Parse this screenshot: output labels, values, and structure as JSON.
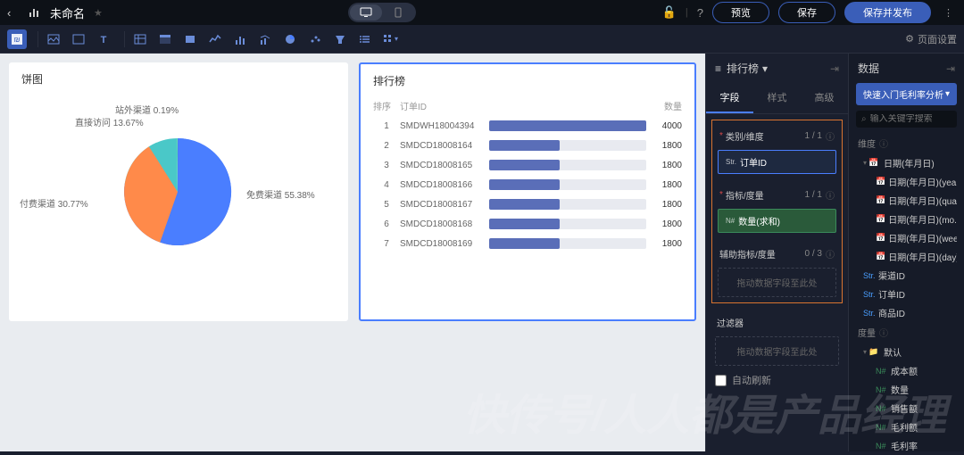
{
  "topbar": {
    "title": "未命名",
    "preview": "预览",
    "save": "保存",
    "savePublish": "保存并发布"
  },
  "toolbar": {
    "pageSettings": "页面设置"
  },
  "pie": {
    "title": "饼图"
  },
  "chart_data": {
    "type": "pie",
    "title": "饼图",
    "slices": [
      {
        "label": "免费渠道",
        "value": 55.38,
        "color": "#4a7eff"
      },
      {
        "label": "付费渠道",
        "value": 30.77,
        "color": "#ff8a4a"
      },
      {
        "label": "直接访问",
        "value": 13.67,
        "color": "#4ac8c8"
      },
      {
        "label": "站外渠道",
        "value": 0.19,
        "color": "#5ad8a0"
      }
    ],
    "labels": {
      "l1": "站外渠道 0.19%",
      "l2": "直接访问 13.67%",
      "l3": "付费渠道 30.77%",
      "l4": "免费渠道 55.38%"
    }
  },
  "rank": {
    "title": "排行榜",
    "cols": {
      "c1": "排序",
      "c2": "订单ID",
      "c4": "数量"
    },
    "rows": [
      {
        "idx": "1",
        "id": "SMDWH18004394",
        "val": "4000",
        "pct": 100
      },
      {
        "idx": "2",
        "id": "SMDCD18008164",
        "val": "1800",
        "pct": 45
      },
      {
        "idx": "3",
        "id": "SMDCD18008165",
        "val": "1800",
        "pct": 45
      },
      {
        "idx": "4",
        "id": "SMDCD18008166",
        "val": "1800",
        "pct": 45
      },
      {
        "idx": "5",
        "id": "SMDCD18008167",
        "val": "1800",
        "pct": 45
      },
      {
        "idx": "6",
        "id": "SMDCD18008168",
        "val": "1800",
        "pct": 45
      },
      {
        "idx": "7",
        "id": "SMDCD18008169",
        "val": "1800",
        "pct": 45
      }
    ]
  },
  "config": {
    "title": "排行榜",
    "tabs": {
      "field": "字段",
      "style": "样式",
      "advanced": "高级"
    },
    "sections": {
      "category": {
        "label": "类别/维度",
        "count": "1 / 1"
      },
      "metric": {
        "label": "指标/度量",
        "count": "1 / 1"
      },
      "aux": {
        "label": "辅助指标/度量",
        "count": "0 / 3"
      }
    },
    "fields": {
      "orderId": "订单ID",
      "qtySum": "数量(求和)"
    },
    "dropHint": "拖动数据字段至此处",
    "filter": "过滤器",
    "autoRefresh": "自动刷新"
  },
  "dataPanel": {
    "title": "数据",
    "dataset": "快速入门毛利率分析",
    "searchPlaceholder": "输入关键字搜索",
    "dimension": "维度",
    "measure": "度量",
    "items": {
      "date": "日期(年月日)",
      "dateYear": "日期(年月日)(year)",
      "dateQuarter": "日期(年月日)(qua...",
      "dateMonth": "日期(年月日)(mo...",
      "dateWeek": "日期(年月日)(week)",
      "dateDay": "日期(年月日)(day)",
      "channelId": "渠道ID",
      "orderId": "订单ID",
      "productId": "商品ID",
      "default": "默认",
      "cost": "成本额",
      "qty": "数量",
      "sales": "销售额",
      "profit": "毛利额",
      "profitRate": "毛利率"
    }
  },
  "watermark": "快传号/人人都是产品经理"
}
